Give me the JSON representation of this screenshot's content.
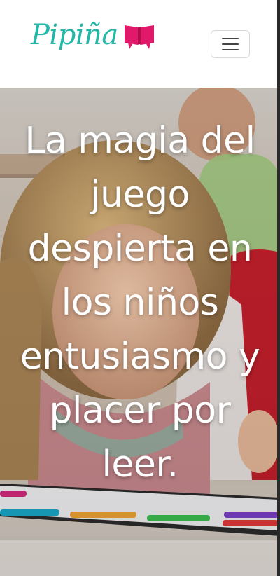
{
  "header": {
    "logo": {
      "text": "Pipiña",
      "icon": "book-icon",
      "text_color": "#22b7a6",
      "icon_color": "#e0196b"
    },
    "menu_toggle": {
      "icon": "hamburger-menu-icon"
    }
  },
  "hero": {
    "title": "La magia del juego despierta en los niños entusiasmo y placer por leer.",
    "image": "hero-photo-children-reading"
  }
}
